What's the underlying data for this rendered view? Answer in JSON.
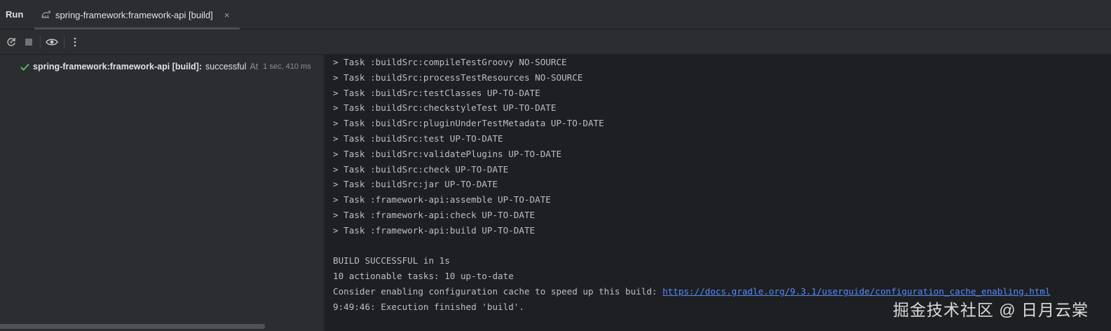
{
  "header": {
    "run_label": "Run",
    "tab_label": "spring-framework:framework-api [build]",
    "tab_close": "×"
  },
  "toolbar": {
    "buttons": [
      "rerun-icon",
      "stop-icon",
      "eye-icon",
      "more-vert-icon"
    ]
  },
  "tree": {
    "task": "spring-framework:framework-api [build]:",
    "status": "successful",
    "at": "At",
    "time": "1 sec, 410 ms"
  },
  "console": {
    "lines": [
      "> Task :buildSrc:compileTestGroovy NO-SOURCE",
      "> Task :buildSrc:processTestResources NO-SOURCE",
      "> Task :buildSrc:testClasses UP-TO-DATE",
      "> Task :buildSrc:checkstyleTest UP-TO-DATE",
      "> Task :buildSrc:pluginUnderTestMetadata UP-TO-DATE",
      "> Task :buildSrc:test UP-TO-DATE",
      "> Task :buildSrc:validatePlugins UP-TO-DATE",
      "> Task :buildSrc:check UP-TO-DATE",
      "> Task :buildSrc:jar UP-TO-DATE",
      "> Task :framework-api:assemble UP-TO-DATE",
      "> Task :framework-api:check UP-TO-DATE",
      "> Task :framework-api:build UP-TO-DATE",
      "",
      "BUILD SUCCESSFUL in 1s",
      "10 actionable tasks: 10 up-to-date"
    ],
    "config_cache_text": "Consider enabling configuration cache to speed up this build: ",
    "config_cache_link": "https://docs.gradle.org/9.3.1/userguide/configuration_cache_enabling.html",
    "finished_line": "9:49:46: Execution finished 'build'."
  },
  "watermark": "掘金技术社区 @ 日月云棠",
  "colors": {
    "background": "#2b2d30",
    "console_bg": "#1e1f22",
    "success": "#5fb865",
    "link": "#548af7"
  }
}
